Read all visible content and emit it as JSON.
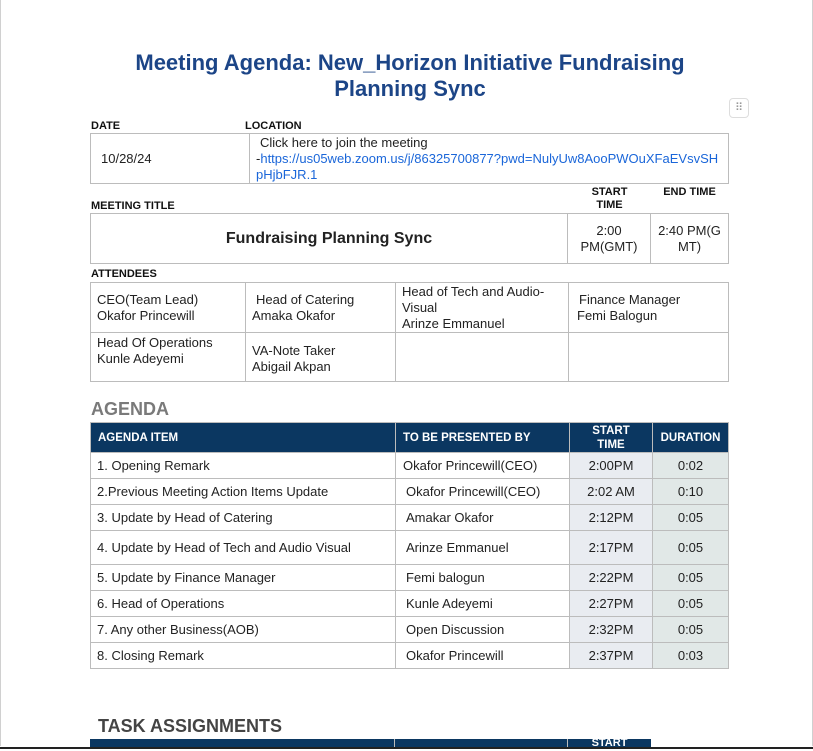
{
  "title": "Meeting Agenda: New_Horizon Initiative Fundraising Planning Sync",
  "labels": {
    "date": "DATE",
    "location": "LOCATION",
    "meeting_title": "MEETING TITLE",
    "start_time": "START TIME",
    "end_time": "END TIME",
    "attendees": "ATTENDEES"
  },
  "date": "10/28/24",
  "location": {
    "text": "Click here to join the meeting",
    "dash": "-",
    "link": "https://us05web.zoom.us/j/86325700877?pwd=NulyUw8AooPWOuXFaEVsvSHpHjbFJR.1"
  },
  "meeting": {
    "title": "Fundraising Planning Sync",
    "start": "2:00 PM(GMT)",
    "end": "2:40 PM(GMT)"
  },
  "attendees": [
    {
      "role": "CEO(Team Lead)",
      "name": "Okafor Princewill"
    },
    {
      "role": "Head of Catering",
      "name": "Amaka Okafor"
    },
    {
      "role": "Head of Tech and Audio-Visual",
      "name": "Arinze Emmanuel"
    },
    {
      "role": "Finance Manager",
      "name": "Femi Balogun"
    },
    {
      "role": "Head Of Operations",
      "name": "Kunle Adeyemi"
    },
    {
      "role": "VA-Note Taker",
      "name": "Abigail Akpan"
    }
  ],
  "agenda": {
    "heading": "AGENDA",
    "columns": [
      "AGENDA ITEM",
      "TO BE PRESENTED BY",
      "START TIME",
      "DURATION"
    ],
    "rows": [
      {
        "item": "1. Opening Remark",
        "by": "Okafor Princewill(CEO)",
        "start": "2:00PM",
        "dur": "0:02"
      },
      {
        "item": "2.Previous Meeting Action Items Update",
        "by": "Okafor Princewill(CEO)",
        "start": "2:02 AM",
        "dur": "0:10"
      },
      {
        "item": "3. Update by Head of Catering",
        "by": "Amakar Okafor",
        "start": "2:12PM",
        "dur": "0:05"
      },
      {
        "item": "4. Update by Head of Tech and Audio Visual",
        "by": "Arinze Emmanuel",
        "start": "2:17PM",
        "dur": "0:05"
      },
      {
        "item": "5. Update by Finance Manager",
        "by": "Femi balogun",
        "start": "2:22PM",
        "dur": "0:05"
      },
      {
        "item": "6. Head of Operations",
        "by": "Kunle Adeyemi",
        "start": "2:27PM",
        "dur": "0:05"
      },
      {
        "item": "7. Any other Business(AOB)",
        "by": "Open Discussion",
        "start": "2:32PM",
        "dur": "0:05"
      },
      {
        "item": "8. Closing Remark",
        "by": "Okafor Princewill",
        "start": "2:37PM",
        "dur": "0:03"
      }
    ]
  },
  "tasks": {
    "heading": "TASK ASSIGNMENTS",
    "partial_header": "START"
  }
}
